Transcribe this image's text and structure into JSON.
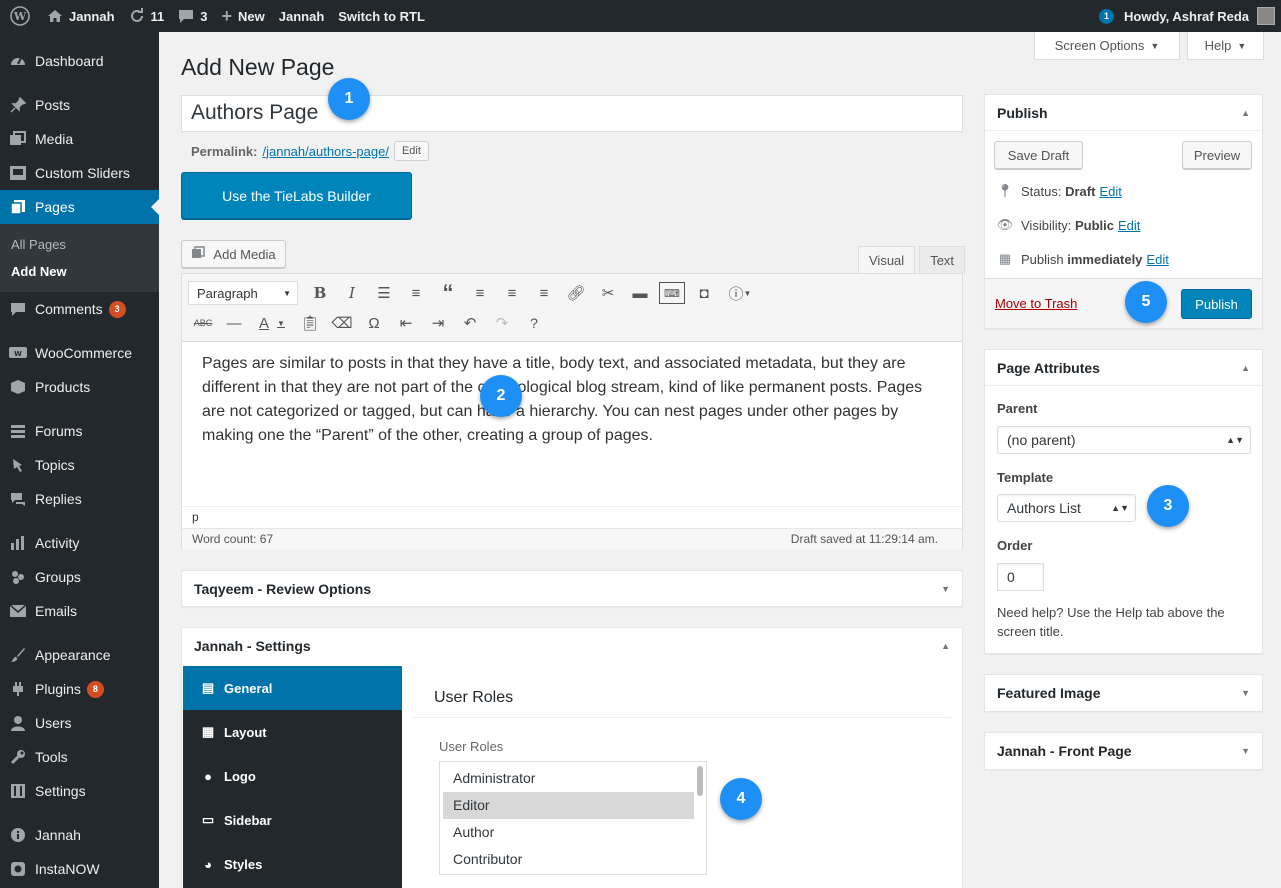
{
  "admin_bar": {
    "site": "Jannah",
    "updates": "11",
    "comments": "3",
    "new": "New",
    "theme": "Jannah",
    "rtl": "Switch to RTL",
    "notifications": "1",
    "greeting": "Howdy, Ashraf Reda"
  },
  "sidebar": {
    "items": [
      {
        "label": "Dashboard"
      },
      {
        "label": "Posts"
      },
      {
        "label": "Media"
      },
      {
        "label": "Custom Sliders"
      },
      {
        "label": "Pages"
      },
      {
        "label": "Comments",
        "count": "3"
      },
      {
        "label": "WooCommerce"
      },
      {
        "label": "Products"
      },
      {
        "label": "Forums"
      },
      {
        "label": "Topics"
      },
      {
        "label": "Replies"
      },
      {
        "label": "Activity"
      },
      {
        "label": "Groups"
      },
      {
        "label": "Emails"
      },
      {
        "label": "Appearance"
      },
      {
        "label": "Plugins",
        "count": "8"
      },
      {
        "label": "Users"
      },
      {
        "label": "Tools"
      },
      {
        "label": "Settings"
      },
      {
        "label": "Jannah"
      },
      {
        "label": "InstaNOW"
      }
    ],
    "submenu": [
      "All Pages",
      "Add New"
    ]
  },
  "screen_options": "Screen Options",
  "help": "Help",
  "page_title": "Add New Page",
  "title_value": "Authors Page",
  "permalink": {
    "label": "Permalink:",
    "url": "/jannah/authors-page/",
    "edit": "Edit"
  },
  "tielabs_button": "Use the TieLabs Builder",
  "add_media": "Add Media",
  "editor_tabs": {
    "visual": "Visual",
    "text": "Text"
  },
  "format_select": "Paragraph",
  "content": "Pages are similar to posts in that they have a title, body text, and associated metadata, but they are different in that they are not part of the chronological blog stream, kind of like permanent posts. Pages are not categorized or tagged, but can have a hierarchy. You can nest pages under other pages by making one the “Parent” of the other, creating a group of pages.",
  "path": "p",
  "word_count": "Word count: 67",
  "draft_saved": "Draft saved at 11:29:14 am.",
  "taqyeem": "Taqyeem - Review Options",
  "jannah_settings": {
    "title": "Jannah - Settings",
    "nav": [
      "General",
      "Layout",
      "Logo",
      "Sidebar",
      "Styles"
    ],
    "section_title": "User Roles",
    "field_label": "User Roles",
    "roles": [
      "Administrator",
      "Editor",
      "Author",
      "Contributor"
    ],
    "selected_role": "Editor"
  },
  "publish": {
    "title": "Publish",
    "save_draft": "Save Draft",
    "preview": "Preview",
    "status_label": "Status:",
    "status_value": "Draft",
    "visibility_label": "Visibility:",
    "visibility_value": "Public",
    "publish_label": "Publish",
    "publish_value": "immediately",
    "edit": "Edit",
    "trash": "Move to Trash",
    "publish_button": "Publish"
  },
  "page_attributes": {
    "title": "Page Attributes",
    "parent_label": "Parent",
    "parent_value": "(no parent)",
    "template_label": "Template",
    "template_value": "Authors List",
    "order_label": "Order",
    "order_value": "0",
    "help": "Need help? Use the Help tab above the screen title."
  },
  "featured_image": "Featured Image",
  "front_page": "Jannah - Front Page",
  "markers": [
    "1",
    "2",
    "3",
    "4",
    "5"
  ],
  "colors": {
    "accent": "#0073aa",
    "marker": "#1e90f5",
    "sidebar": "#23282d",
    "trash": "#a00"
  }
}
